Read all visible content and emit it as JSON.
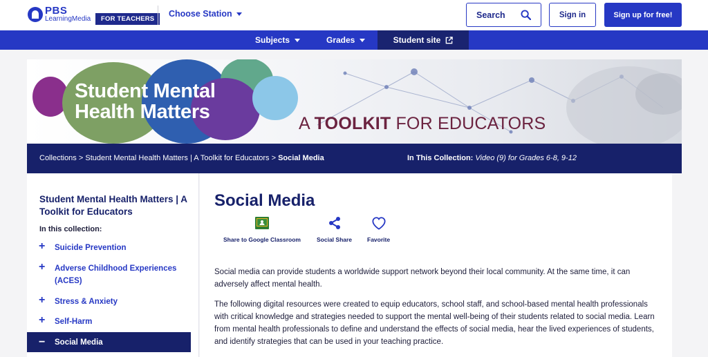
{
  "header": {
    "logo_pbs": "PBS",
    "logo_sub": "LearningMedia",
    "teachers_badge": "FOR TEACHERS",
    "choose_station": "Choose Station",
    "search_label": "Search",
    "signin_label": "Sign in",
    "signup_label": "Sign up for free!"
  },
  "nav": {
    "subjects": "Subjects",
    "grades": "Grades",
    "student_site": "Student site"
  },
  "banner": {
    "title_line1": "Student Mental",
    "title_line2": "Health Matters",
    "subtitle_prefix": "A ",
    "subtitle_bold": "TOOLKIT",
    "subtitle_suffix": " FOR EDUCATORS"
  },
  "breadcrumb": {
    "items": [
      "Collections",
      "Student Mental Health Matters | A Toolkit for Educators"
    ],
    "separator": " > ",
    "current": "Social Media"
  },
  "collection_info": {
    "label": "In This Collection:",
    "value": "Video (9) for Grades 6-8, 9-12"
  },
  "sidebar": {
    "title": "Student Mental Health Matters | A Toolkit for Educators",
    "in_collection": "In this collection:",
    "items": [
      {
        "label": "Suicide Prevention",
        "icon": "plus"
      },
      {
        "label": "Adverse Childhood Experiences (ACES)",
        "icon": "plus"
      },
      {
        "label": "Stress & Anxiety",
        "icon": "plus"
      },
      {
        "label": "Self-Harm",
        "icon": "plus"
      },
      {
        "label": "Social Media",
        "icon": "minus"
      }
    ]
  },
  "main": {
    "title": "Social Media",
    "actions": [
      {
        "label": "Share to Google Classroom",
        "icon": "google-classroom-icon"
      },
      {
        "label": "Social Share",
        "icon": "share-icon"
      },
      {
        "label": "Favorite",
        "icon": "heart-icon"
      }
    ],
    "paragraph1": "Social media can provide students a worldwide support network beyond their local community. At the same time, it can adversely affect mental health.",
    "paragraph2": "The following digital resources were created to equip educators, school staff, and school-based mental health professionals with critical knowledge and strategies needed to support the mental well-being of their students related to social media. Learn from mental health professionals to define and understand the effects of social media, hear the lived experiences of students, and identify strategies that can be used in your teaching practice."
  },
  "colors": {
    "brand_blue": "#2638c4",
    "navy": "#17216a",
    "banner_text": "#6b2340"
  }
}
